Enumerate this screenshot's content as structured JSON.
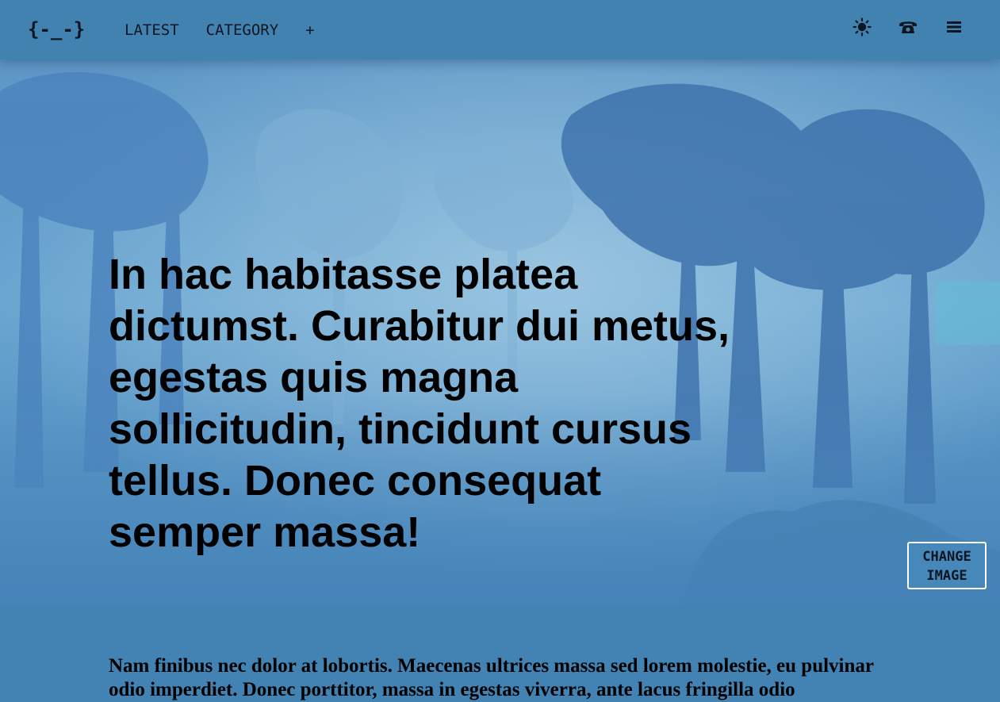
{
  "header": {
    "logo": "{-_-}",
    "nav": {
      "latest": "LATEST",
      "category": "CATEGORY",
      "more": "+"
    },
    "icons": [
      "sun-icon",
      "phone-icon",
      "menu-icon"
    ]
  },
  "hero": {
    "title": "In hac habitasse platea dictumst. Curabitur dui metus, egestas quis magna sollicitudin, tincidunt cursus tellus. Donec consequat semper massa!",
    "change_image_label": "CHANGE IMAGE"
  },
  "content": {
    "paragraph": "Nam finibus nec dolor at lobortis. Maecenas ultrices massa sed lorem molestie, eu pulvinar odio imperdiet. Donec porttitor, massa in egestas viverra, ante lacus fringilla odio"
  },
  "colors": {
    "header_bg": "#4182b1",
    "page_bg": "#4283b3",
    "text": "#0d1620"
  }
}
